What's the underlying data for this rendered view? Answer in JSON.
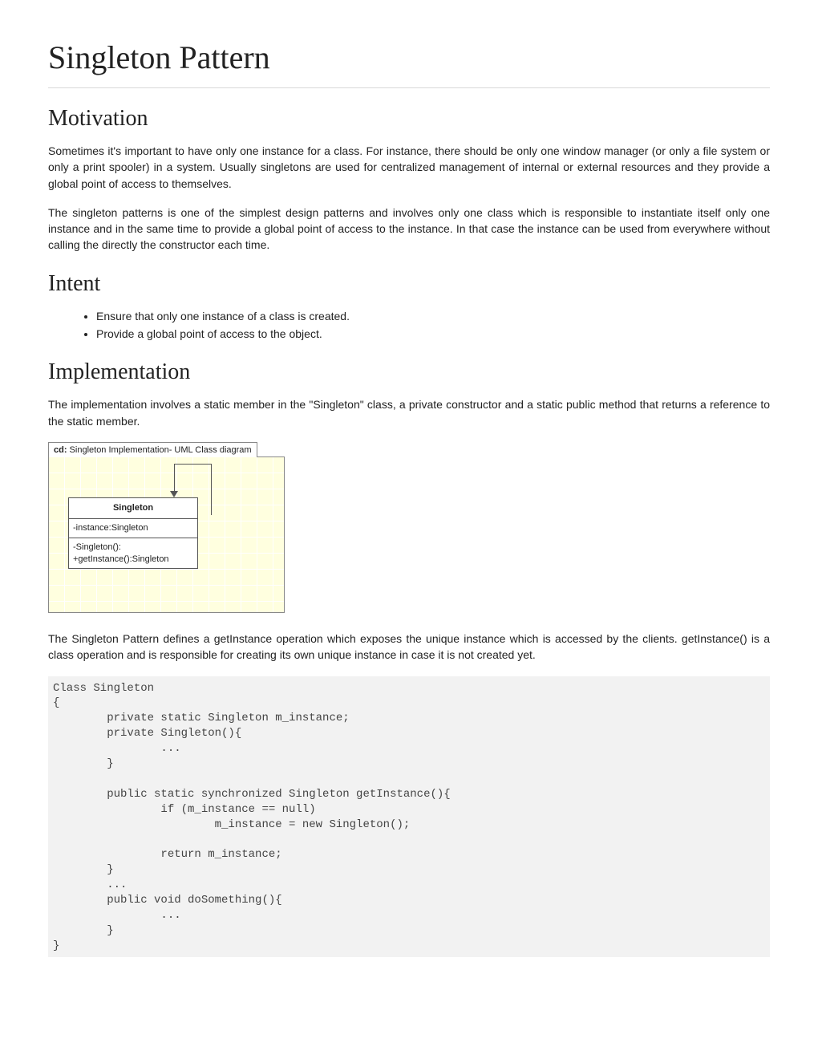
{
  "title": "Singleton Pattern",
  "sections": {
    "motivation": {
      "heading": "Motivation",
      "para1": "Sometimes it's important to have only one instance for a class. For instance, there should be only one window manager (or only a file system or only a print spooler) in a system. Usually singletons are used for centralized management of internal or external resources and they provide a global point of access to themselves.",
      "para2": "The singleton patterns is one of the simplest design patterns and involves only one class which is responsible to instantiate itself only one instance and in the same time to provide a global point of access to the instance. In that case the instance can be used from everywhere without calling the directly the constructor each time."
    },
    "intent": {
      "heading": "Intent",
      "items": [
        "Ensure that only one instance of a class is created.",
        "Provide a global point of access to the object."
      ]
    },
    "implementation": {
      "heading": "Implementation",
      "para1": "The implementation involves a static member in the \"Singleton\" class, a private constructor and a static public method that returns a reference to the static member.",
      "para2": "The Singleton Pattern defines a getInstance operation which exposes the unique instance which is accessed by the clients. getInstance() is a class operation and is responsible for creating its own unique instance in case it is not created yet."
    }
  },
  "uml": {
    "tab_prefix": "cd:",
    "tab_text": " Singleton Implementation- UML Class diagram",
    "class_name": "Singleton",
    "attributes": "-instance:Singleton",
    "op1": "-Singleton():",
    "op2": "+getInstance():Singleton"
  },
  "code": "Class Singleton\n{\n        private static Singleton m_instance;\n        private Singleton(){\n                ...\n        }\n\n        public static synchronized Singleton getInstance(){\n                if (m_instance == null)\n                        m_instance = new Singleton();\n\n                return m_instance;\n        }\n        ...\n        public void doSomething(){\n                ...\n        }\n}"
}
